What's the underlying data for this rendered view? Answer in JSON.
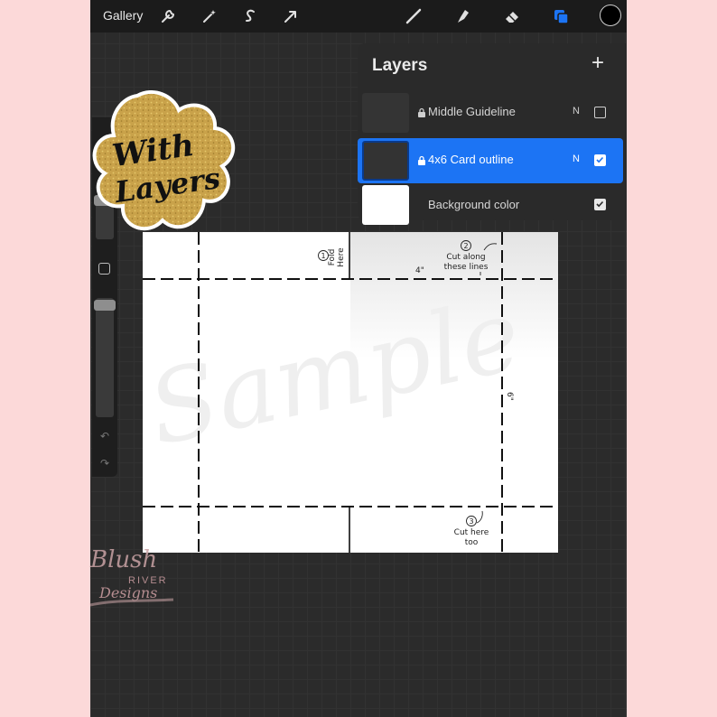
{
  "toolbar": {
    "gallery_label": "Gallery",
    "tools_left": [
      "wrench-icon",
      "magic-wand-icon",
      "selection-s-icon",
      "arrow-transform-icon"
    ],
    "tools_right": [
      "brush-icon",
      "smudge-icon",
      "eraser-icon",
      "layers-icon"
    ],
    "color": "#000000"
  },
  "layers": {
    "title": "Layers",
    "add_label": "+",
    "rows": [
      {
        "name": "Middle Guideline",
        "blend": "N",
        "locked": true,
        "visible": false,
        "selected": false
      },
      {
        "name": "4x6 Card outline",
        "blend": "N",
        "locked": true,
        "visible": true,
        "selected": true
      },
      {
        "name": "Background color",
        "blend": "",
        "locked": false,
        "visible": true,
        "selected": false
      }
    ]
  },
  "sticker": {
    "text_line1": "With",
    "text_line2": "Layers"
  },
  "canvas": {
    "note1_num": "①",
    "note1_line1": "Fold",
    "note1_line2": "Here",
    "note2_num": "②",
    "note2_line1": "Cut along",
    "note2_line2": "these lines",
    "note3_num": "③",
    "note3_line1": "Cut here",
    "note3_line2": "too",
    "dim_width": "4\"",
    "dim_height": "6\"",
    "watermark": "Sample"
  },
  "brand_watermark": {
    "line1": "Blush",
    "line2": "RIVER",
    "line3": "Designs"
  },
  "colors": {
    "accent": "#1c74f4",
    "background": "#fcd9d9",
    "sticker_gold": "#c9a24a"
  }
}
